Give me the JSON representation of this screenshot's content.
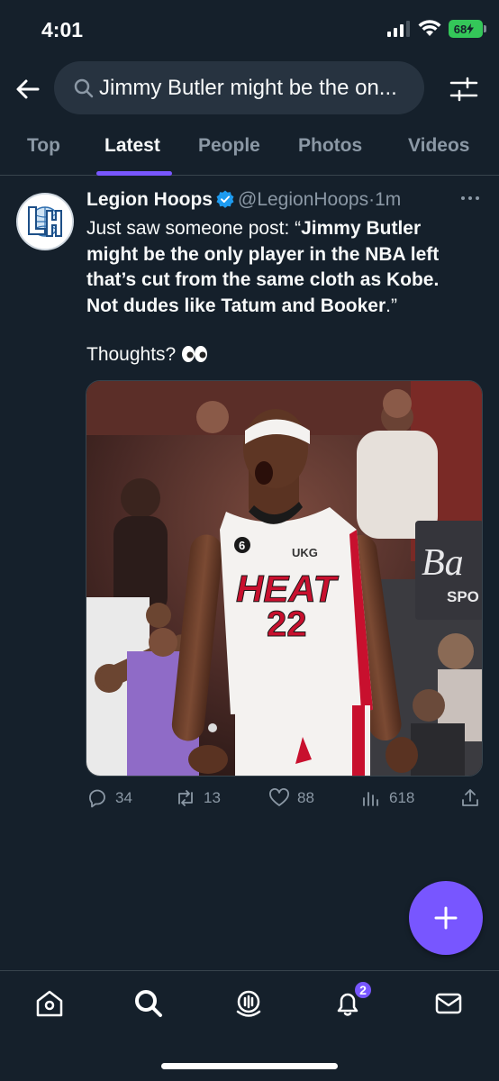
{
  "status_bar": {
    "time": "4:01",
    "battery": "68"
  },
  "search": {
    "query": "Jimmy Butler might be the on..."
  },
  "tabs": [
    {
      "label": "Top"
    },
    {
      "label": "Latest"
    },
    {
      "label": "People"
    },
    {
      "label": "Photos"
    },
    {
      "label": "Videos"
    }
  ],
  "active_tab": "Latest",
  "tweet": {
    "author": "Legion Hoops",
    "handle": "@LegionHoops",
    "separator": "·",
    "time": "1m",
    "text_intro": "Just saw someone post: “",
    "text_bold": "Jimmy Butler might be the only player in the NBA left that’s cut from the same cloth as Kobe. Not dudes like Tatum and Booker",
    "text_end": ".”",
    "thoughts": "Thoughts?",
    "media": {
      "jersey_team": "HEAT",
      "jersey_number": "22",
      "jersey_patch": "6",
      "jersey_sponsor": "UKG",
      "banner_text": "Ba",
      "banner_sub": "SPO"
    },
    "stats": {
      "replies": "34",
      "retweets": "13",
      "likes": "88",
      "views": "618"
    }
  },
  "nav": {
    "notifications_badge": "2"
  },
  "colors": {
    "background": "#15202b",
    "accent": "#7856ff",
    "muted": "#8b98a5"
  }
}
